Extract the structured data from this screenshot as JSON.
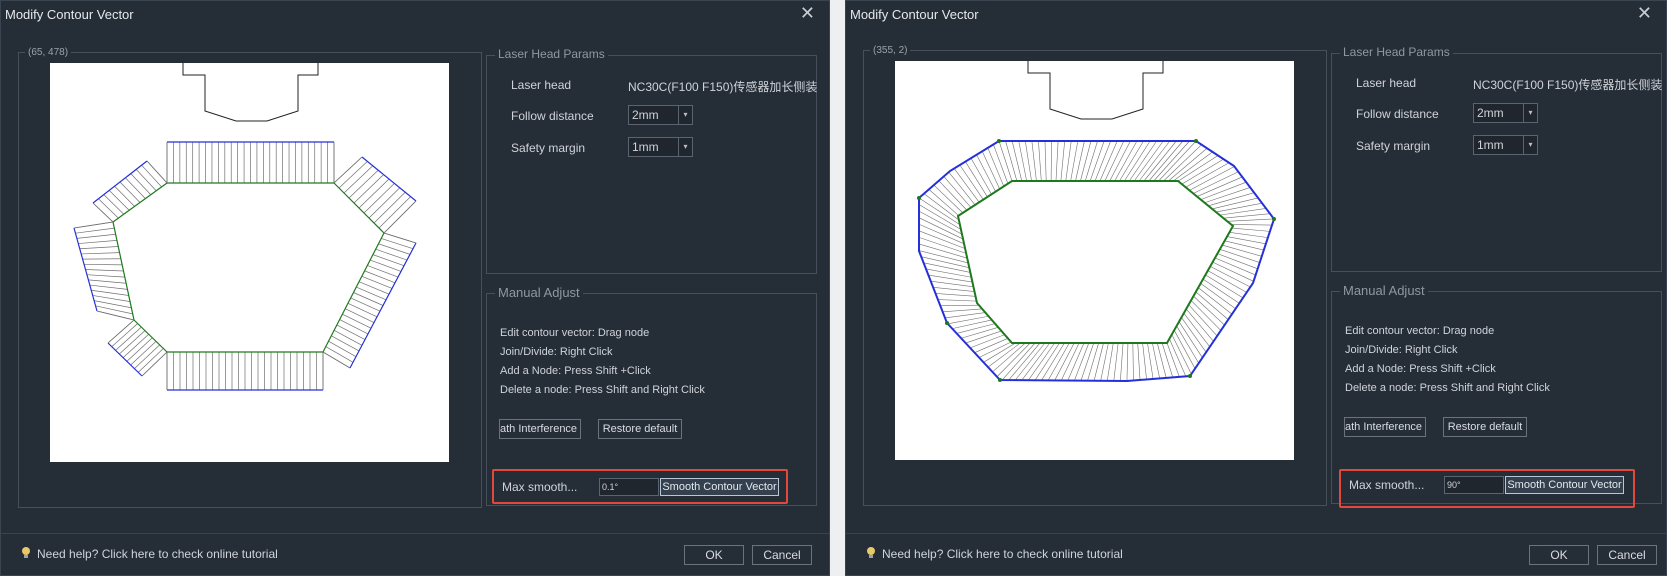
{
  "colors": {
    "dialog_bg": "#252d37",
    "highlight": "#e2483d",
    "contour_outer": "#2430d8",
    "contour_inner": "#1c7a1c",
    "hatch": "#6f6f6f",
    "head": "#222222"
  },
  "dialogs": [
    {
      "title": "Modify Contour Vector",
      "close_icon": "close-icon",
      "coords": "(65, 478)",
      "laser_params": {
        "legend": "Laser Head Params",
        "laser_head_label": "Laser head",
        "laser_head_value": "NC30C(F100 F150)传感器加长侧装",
        "follow_distance_label": "Follow distance",
        "follow_distance_value": "2mm",
        "safety_margin_label": "Safety margin",
        "safety_margin_value": "1mm"
      },
      "manual_adjust": {
        "legend": "Manual Adjust",
        "instructions": [
          "Edit contour vector: Drag node",
          "Join/Divide: Right Click",
          "Add a Node: Press Shift +Click",
          "Delete a node: Press Shift and Right Click"
        ],
        "interference_button": "ath Interference",
        "restore_button": "Restore default",
        "max_smooth_label": "Max smooth...",
        "max_smooth_value": "0.1°",
        "smooth_button": "Smooth Contour Vector"
      },
      "help_text": "Need help? Click here to check online tutorial",
      "ok": "OK",
      "cancel": "Cancel"
    },
    {
      "title": "Modify Contour Vector",
      "close_icon": "close-icon",
      "coords": "(355, 2)",
      "laser_params": {
        "legend": "Laser Head Params",
        "laser_head_label": "Laser head",
        "laser_head_value": "NC30C(F100 F150)传感器加长侧装",
        "follow_distance_label": "Follow distance",
        "follow_distance_value": "2mm",
        "safety_margin_label": "Safety margin",
        "safety_margin_value": "1mm"
      },
      "manual_adjust": {
        "legend": "Manual Adjust",
        "instructions": [
          "Edit contour vector: Drag node",
          "Join/Divide: Right Click",
          "Add a Node: Press Shift +Click",
          "Delete a node: Press Shift and Right Click"
        ],
        "interference_button": "ath Interference",
        "restore_button": "Restore default",
        "max_smooth_label": "Max smooth...",
        "max_smooth_value": "90°",
        "smooth_button": "Smooth Contour Vector"
      },
      "help_text": "Need help? Click here to check online tutorial",
      "ok": "OK",
      "cancel": "Cancel"
    }
  ]
}
